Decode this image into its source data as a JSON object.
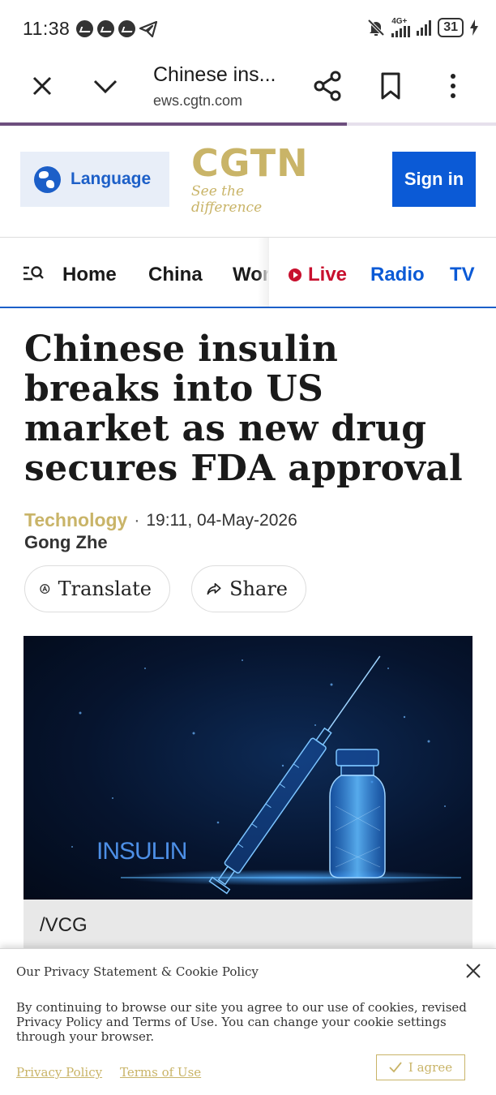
{
  "status_bar": {
    "time": "11:38",
    "network": "4G+",
    "battery": "31"
  },
  "browser": {
    "tab_title": "Chinese ins...",
    "url": "ews.cgtn.com",
    "load_progress": 0.7
  },
  "site_header": {
    "language_label": "Language",
    "logo_text": "CGTN",
    "logo_tagline": "See the difference",
    "signin_label": "Sign in"
  },
  "nav": {
    "items": [
      "Home",
      "China",
      "World"
    ],
    "live_label": "Live",
    "radio_label": "Radio",
    "tv_label": "TV"
  },
  "article": {
    "headline": "Chinese insulin breaks into US market as new drug secures FDA approval",
    "category": "Technology",
    "separator": "·",
    "timestamp": "19:11, 04-May-2026",
    "author": "Gong Zhe",
    "translate_label": "Translate",
    "share_label": "Share",
    "image_text": "INSULIN",
    "image_caption": "/VCG"
  },
  "cookie_banner": {
    "title": "Our Privacy Statement & Cookie Policy",
    "body": "By continuing to browse our site you agree to our use of cookies, revised Privacy Policy and Terms of Use. You can change your cookie settings through your browser.",
    "privacy_link": "Privacy Policy",
    "terms_link": "Terms of Use",
    "agree_label": "I agree"
  },
  "colors": {
    "brand_gold": "#c9b468",
    "brand_blue": "#0b5ad6",
    "live_red": "#c8102e"
  }
}
